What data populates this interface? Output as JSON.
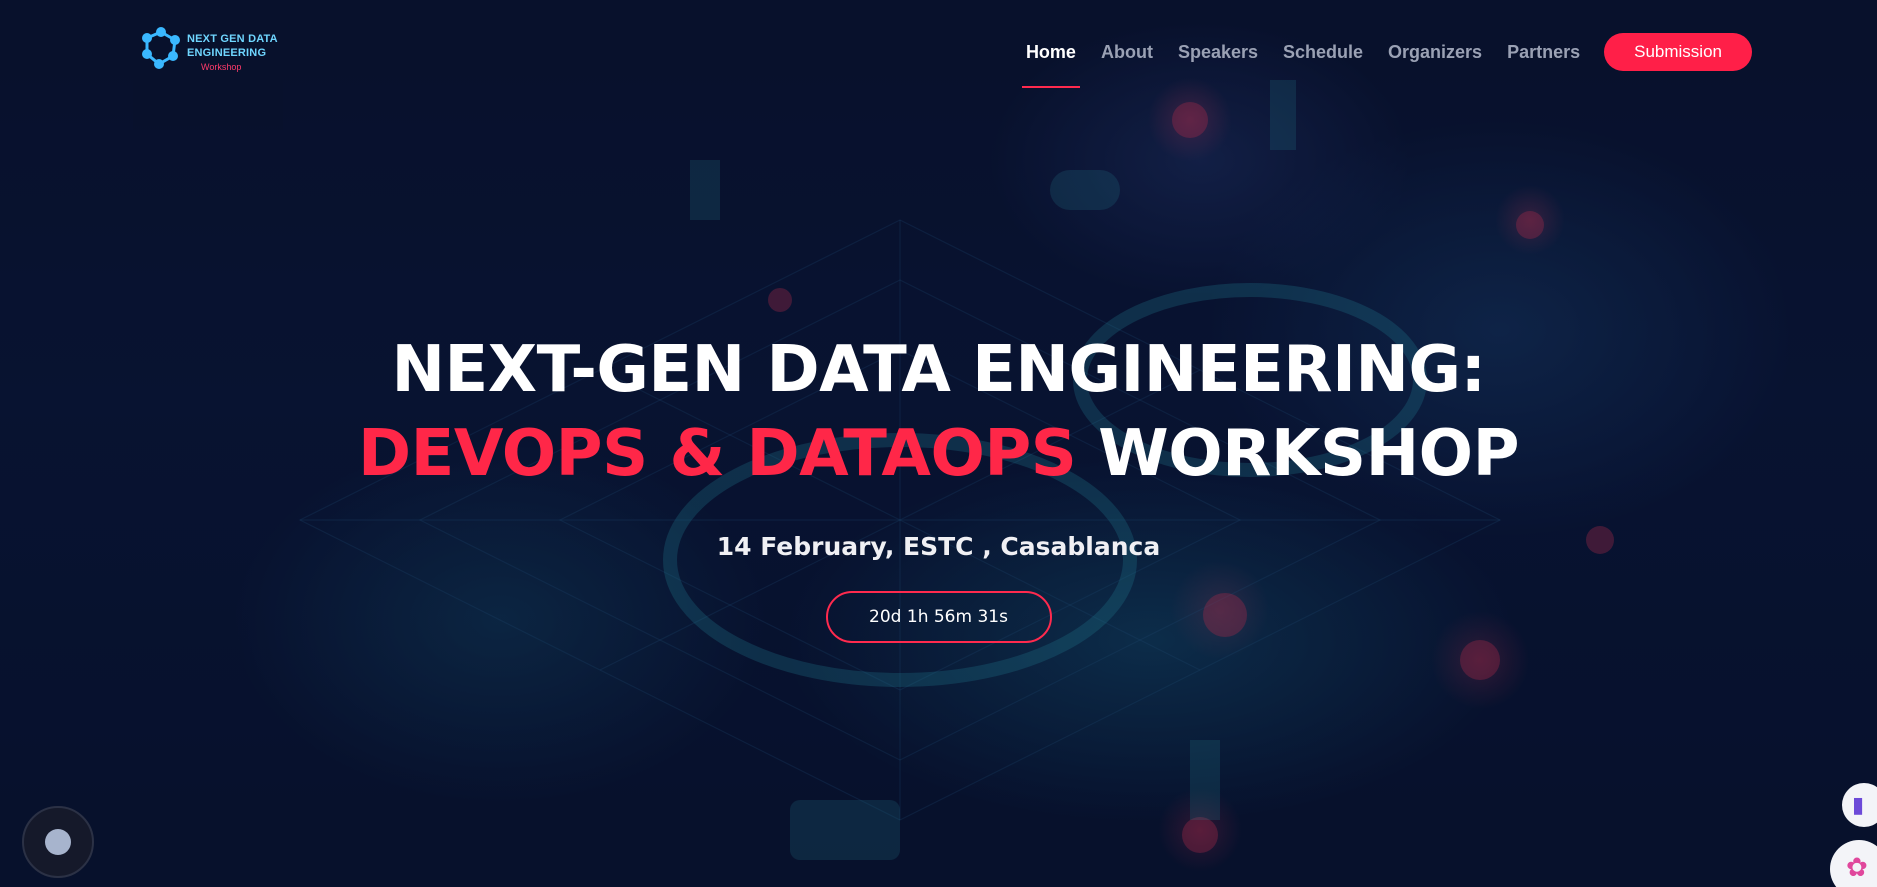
{
  "logo": {
    "line1": "NEXT GEN DATA",
    "line2": "ENGINEERING",
    "sub": "Workshop",
    "icon": "network-nodes-icon"
  },
  "nav": {
    "items": [
      {
        "label": "Home",
        "active": true
      },
      {
        "label": "About",
        "active": false
      },
      {
        "label": "Speakers",
        "active": false
      },
      {
        "label": "Schedule",
        "active": false
      },
      {
        "label": "Organizers",
        "active": false
      },
      {
        "label": "Partners",
        "active": false
      }
    ],
    "cta": "Submission"
  },
  "hero": {
    "title_line1": "NEXT-GEN DATA ENGINEERING:",
    "title_accent": "DEVOPS & DATAOPS",
    "title_rest": " WORKSHOP",
    "date_location": "14 February, ESTC , Casablanca",
    "countdown": "20d 1h 56m 31s"
  },
  "widgets": {
    "left": "circle-dot-icon",
    "right_top": "book-icon",
    "right_bottom": "brain-icon"
  },
  "colors": {
    "accent": "#ff2748",
    "background": "#07102a",
    "nav_inactive": "#9aa1b4",
    "logo_text": "#6fd6ff"
  }
}
